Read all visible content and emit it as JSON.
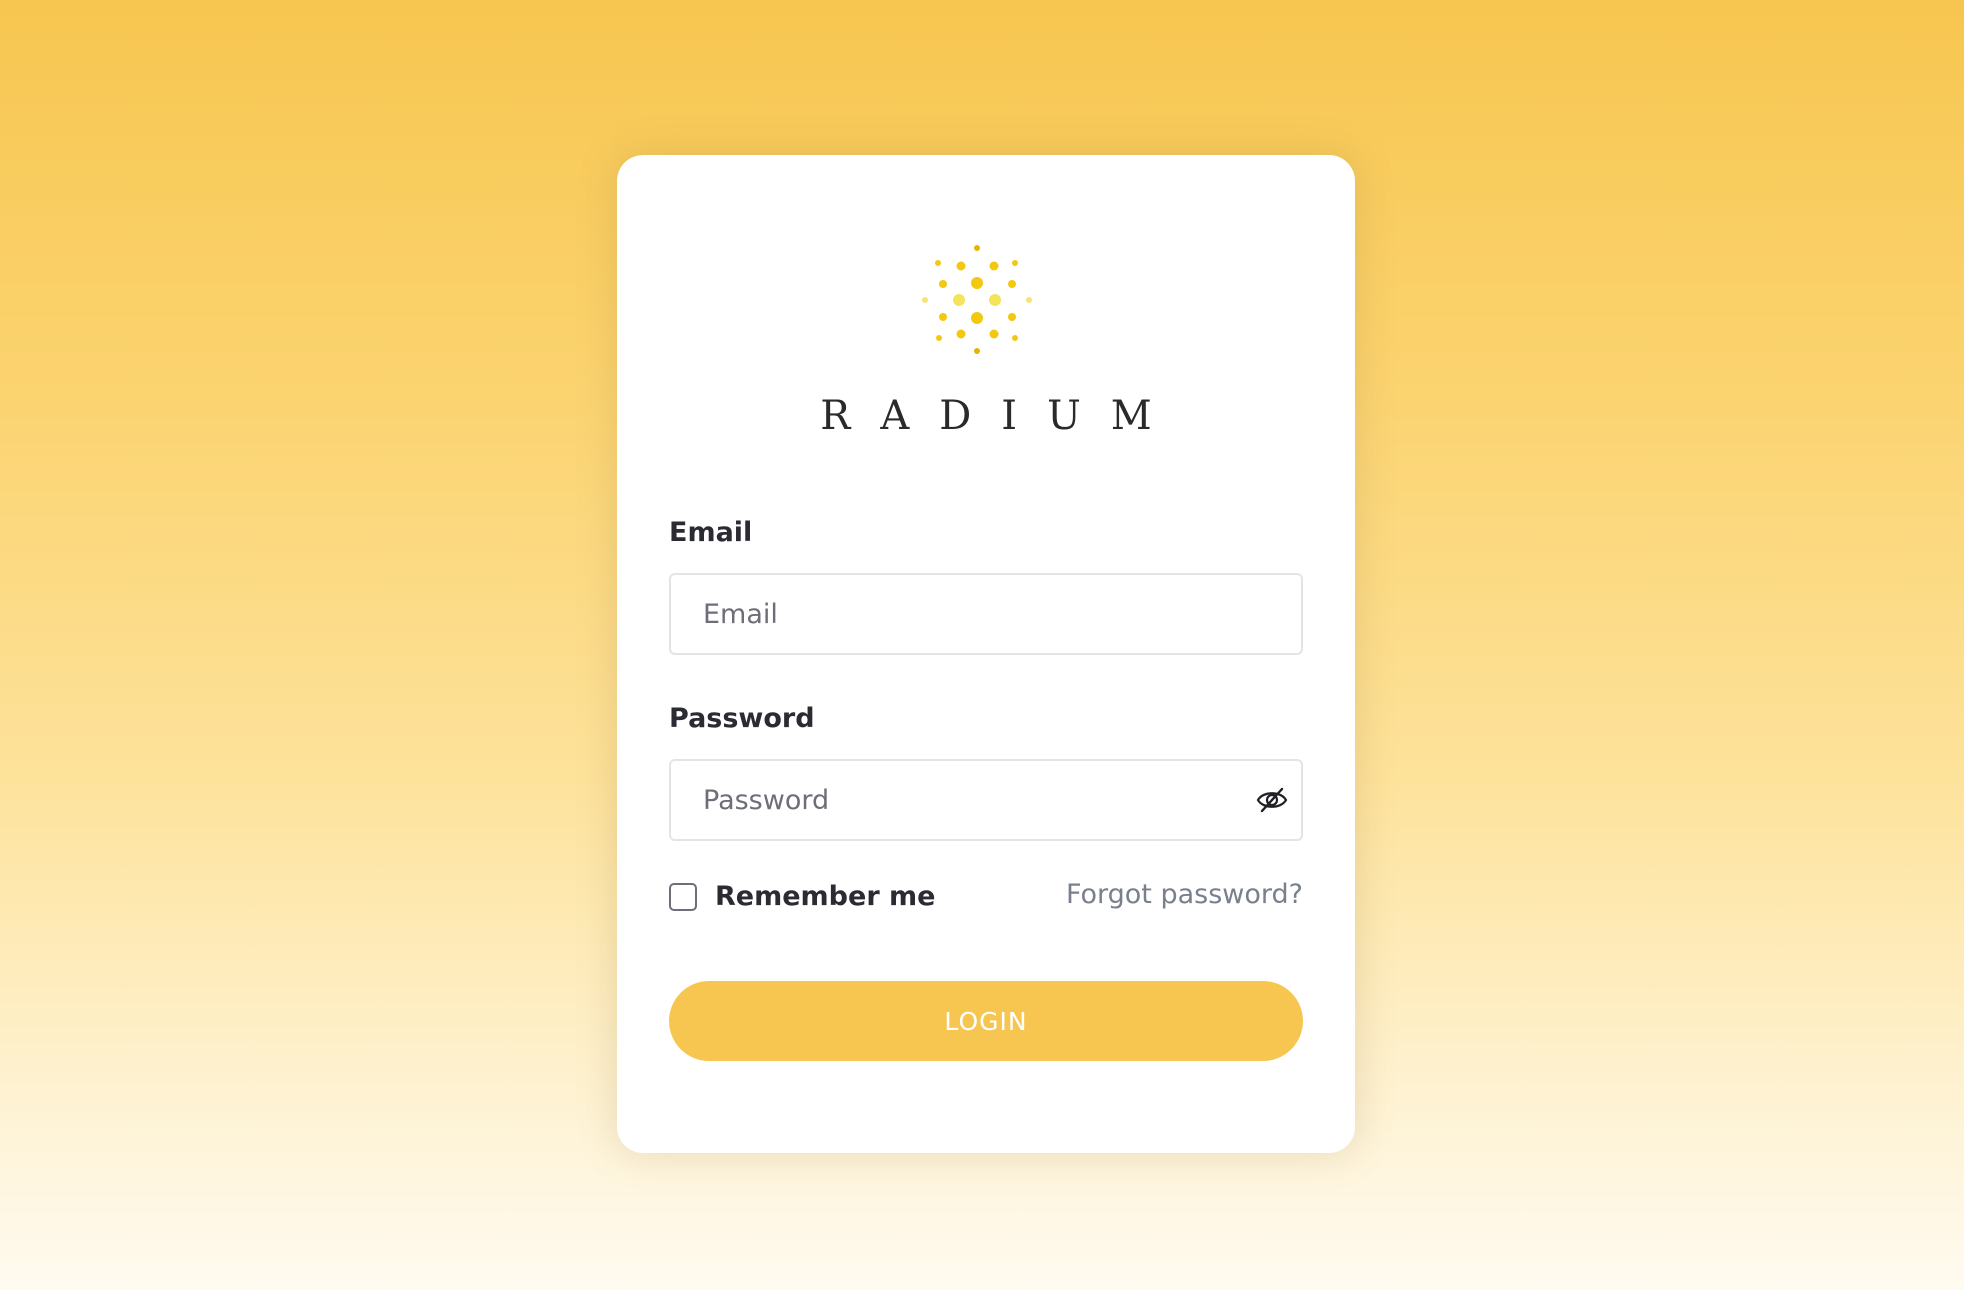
{
  "brand": {
    "name": "RADIUM",
    "logo_icon": "radial-dots-logo",
    "logo_color": "#f2c811"
  },
  "form": {
    "email_label": "Email",
    "email_placeholder": "Email",
    "email_value": "",
    "password_label": "Password",
    "password_placeholder": "Password",
    "password_value": "",
    "password_toggle_icon": "eye-slash-icon",
    "remember_label": "Remember me",
    "remember_checked": false,
    "forgot_label": "Forgot password?",
    "login_label": "LOGIN"
  },
  "colors": {
    "accent": "#f7c650",
    "text": "#2b2b33",
    "muted": "#7a7f8e"
  }
}
